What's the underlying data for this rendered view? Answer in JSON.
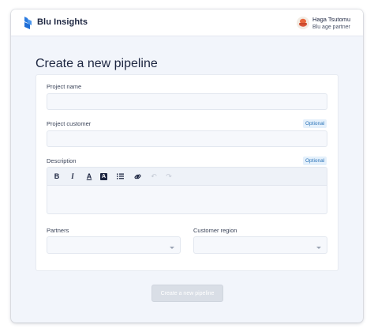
{
  "app": {
    "name": "Blu Insights"
  },
  "user": {
    "name": "Haga Tsutomu",
    "role": "Blu age partner"
  },
  "page": {
    "title": "Create a new pipeline"
  },
  "form": {
    "project_name": {
      "label": "Project name",
      "value": ""
    },
    "project_customer": {
      "label": "Project customer",
      "badge": "Optional",
      "value": ""
    },
    "description": {
      "label": "Description",
      "badge": "Optional",
      "value": "",
      "toolbar": [
        {
          "icon": "bold-icon",
          "glyph": "B",
          "enabled": true
        },
        {
          "icon": "italic-icon",
          "glyph": "I",
          "enabled": true
        },
        {
          "icon": "text-color-icon",
          "glyph": "A",
          "enabled": true
        },
        {
          "icon": "highlight-icon",
          "glyph": "A",
          "enabled": true
        },
        {
          "icon": "list-icon",
          "glyph": "≡",
          "enabled": true
        },
        {
          "icon": "link-icon",
          "glyph": "🔗",
          "enabled": true
        },
        {
          "icon": "undo-icon",
          "glyph": "↶",
          "enabled": false
        },
        {
          "icon": "redo-icon",
          "glyph": "↷",
          "enabled": false
        }
      ]
    },
    "partners": {
      "label": "Partners",
      "value": ""
    },
    "customer_region": {
      "label": "Customer region",
      "value": ""
    },
    "submit_label": "Create a new pipeline"
  },
  "colors": {
    "brand": "#2b7be0",
    "accent_badge": "#2c74b8",
    "disabled_button": "#d9dee6"
  }
}
